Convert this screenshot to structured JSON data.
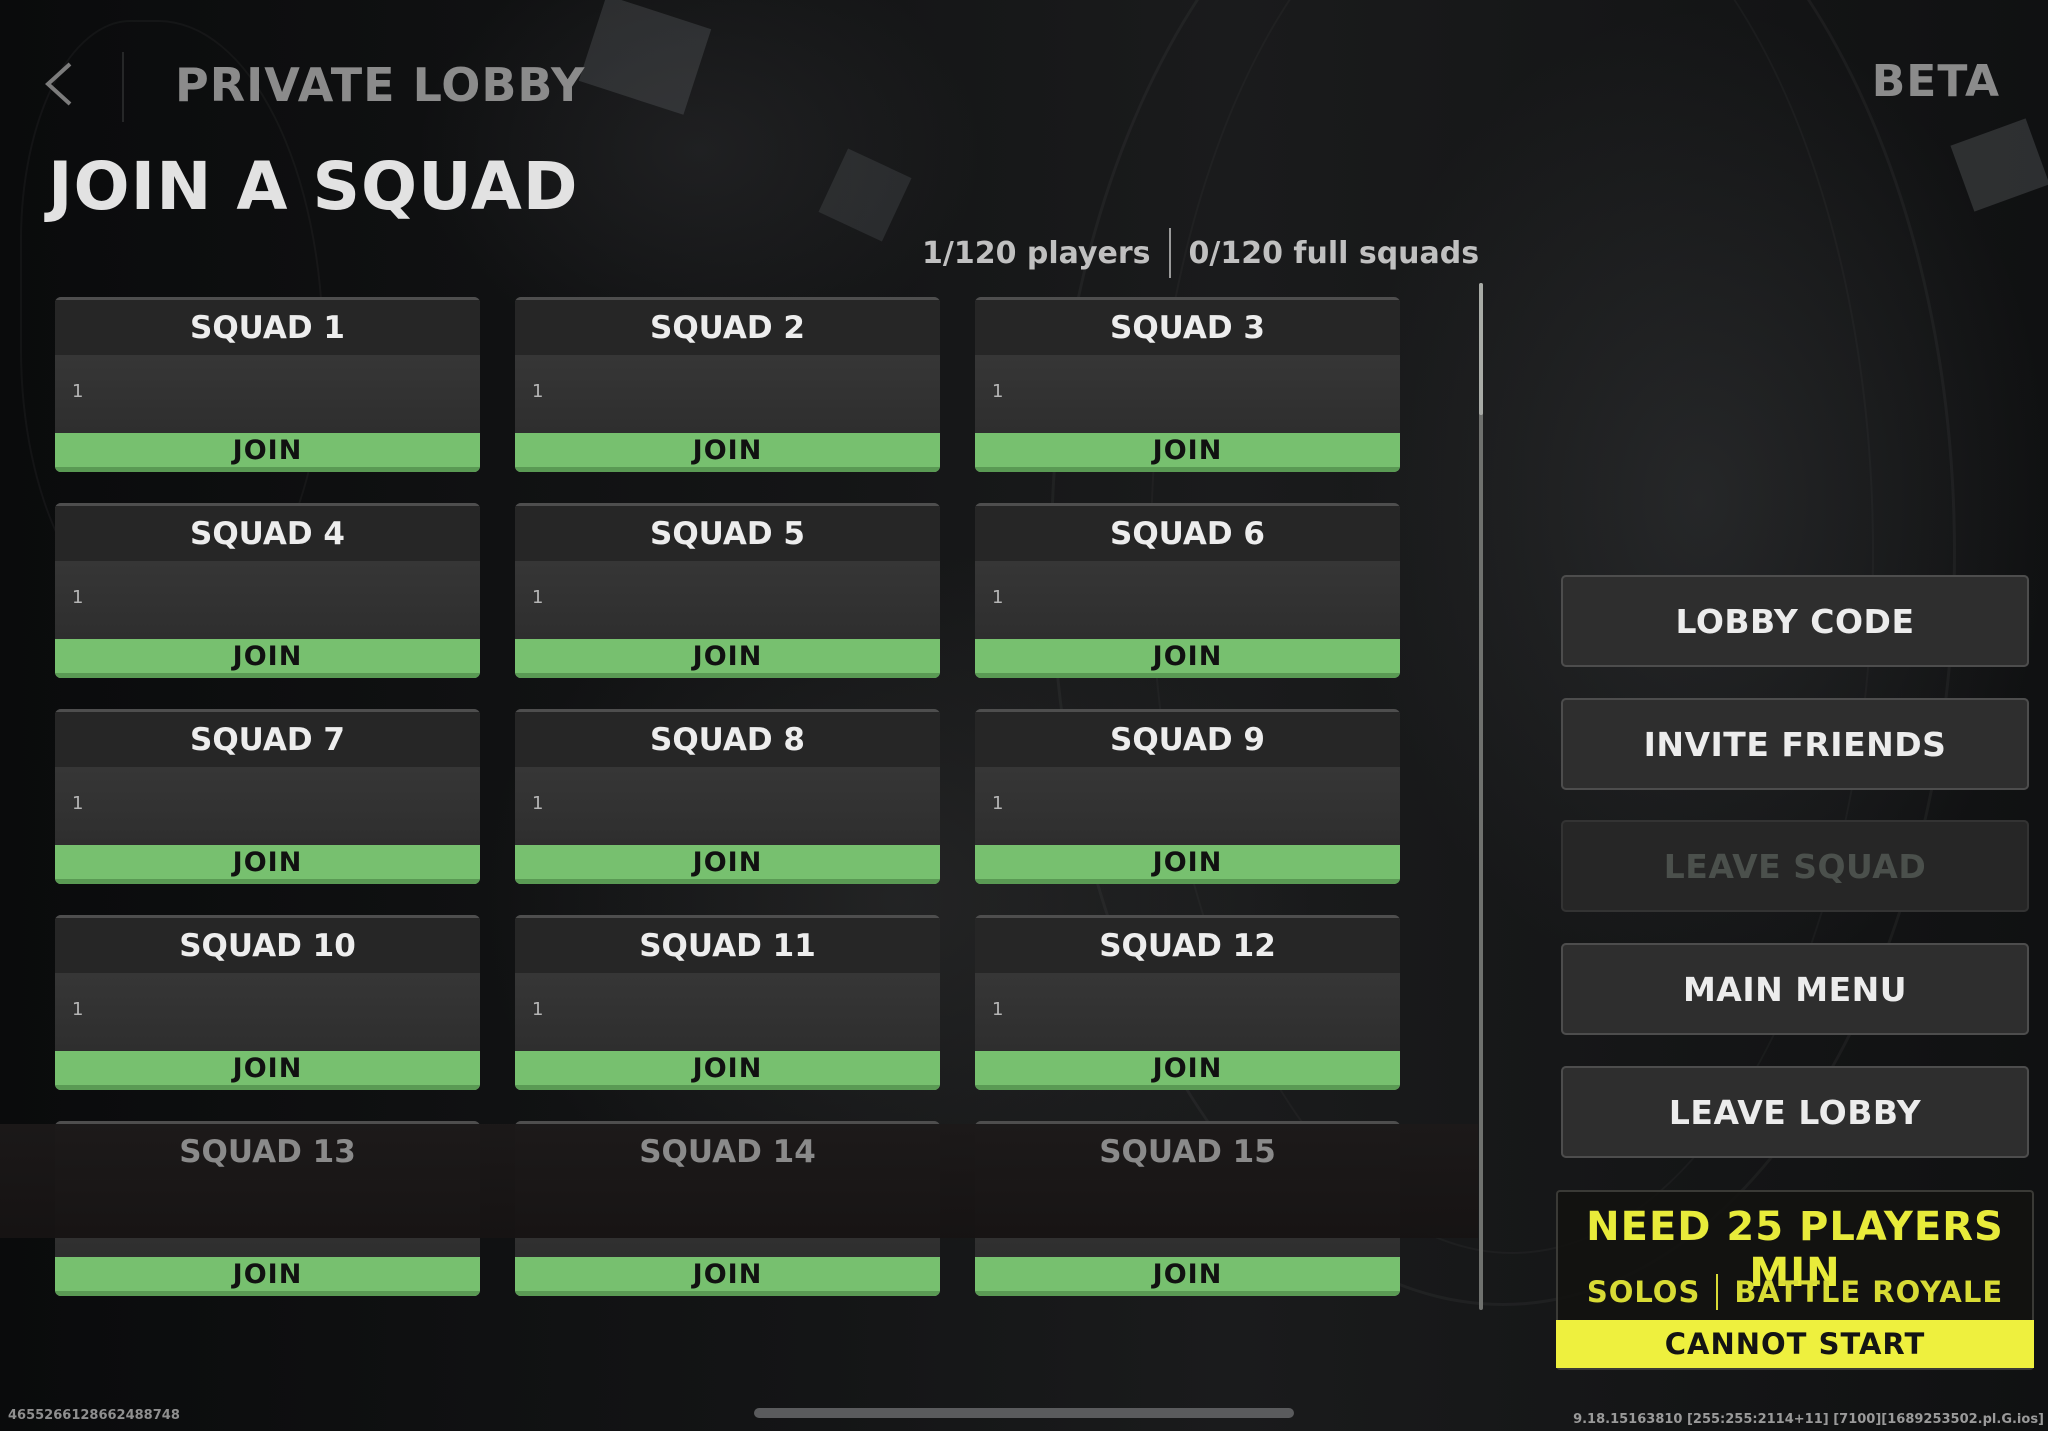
{
  "header": {
    "screen_title": "PRIVATE LOBBY",
    "beta_label": "BETA",
    "back_icon": "chevron-left-icon"
  },
  "main": {
    "heading": "JOIN A SQUAD",
    "stats": {
      "players": "1/120 players",
      "full_squads": "0/120 full squads"
    },
    "squads": [
      {
        "name": "SQUAD 1",
        "slot": "1",
        "join_label": "JOIN"
      },
      {
        "name": "SQUAD 2",
        "slot": "1",
        "join_label": "JOIN"
      },
      {
        "name": "SQUAD 3",
        "slot": "1",
        "join_label": "JOIN"
      },
      {
        "name": "SQUAD 4",
        "slot": "1",
        "join_label": "JOIN"
      },
      {
        "name": "SQUAD 5",
        "slot": "1",
        "join_label": "JOIN"
      },
      {
        "name": "SQUAD 6",
        "slot": "1",
        "join_label": "JOIN"
      },
      {
        "name": "SQUAD 7",
        "slot": "1",
        "join_label": "JOIN"
      },
      {
        "name": "SQUAD 8",
        "slot": "1",
        "join_label": "JOIN"
      },
      {
        "name": "SQUAD 9",
        "slot": "1",
        "join_label": "JOIN"
      },
      {
        "name": "SQUAD 10",
        "slot": "1",
        "join_label": "JOIN"
      },
      {
        "name": "SQUAD 11",
        "slot": "1",
        "join_label": "JOIN"
      },
      {
        "name": "SQUAD 12",
        "slot": "1",
        "join_label": "JOIN"
      },
      {
        "name": "SQUAD 13",
        "slot": "",
        "join_label": "JOIN"
      },
      {
        "name": "SQUAD 14",
        "slot": "",
        "join_label": "JOIN"
      },
      {
        "name": "SQUAD 15",
        "slot": "",
        "join_label": "JOIN"
      }
    ],
    "scroll_position": 0.0
  },
  "sidebar": {
    "buttons": [
      {
        "label": "LOBBY CODE",
        "enabled": true
      },
      {
        "label": "INVITE FRIENDS",
        "enabled": true
      },
      {
        "label": "LEAVE SQUAD",
        "enabled": false
      },
      {
        "label": "MAIN MENU",
        "enabled": true
      },
      {
        "label": "LEAVE LOBBY",
        "enabled": true
      }
    ],
    "status": {
      "title": "NEED 25 PLAYERS MIN",
      "mode": "SOLOS",
      "game_type": "BATTLE ROYALE",
      "action": "CANNOT START"
    }
  },
  "footer": {
    "build_id": "465526612866248874​8",
    "version_info": "9.18.15163810 [255:255:2114+11]  [7100][1689253502.pl.G.ios]"
  },
  "colors": {
    "join_green": "#77c06f",
    "warning_yellow": "#eef03e",
    "panel_dark": "#2e2e2e"
  }
}
